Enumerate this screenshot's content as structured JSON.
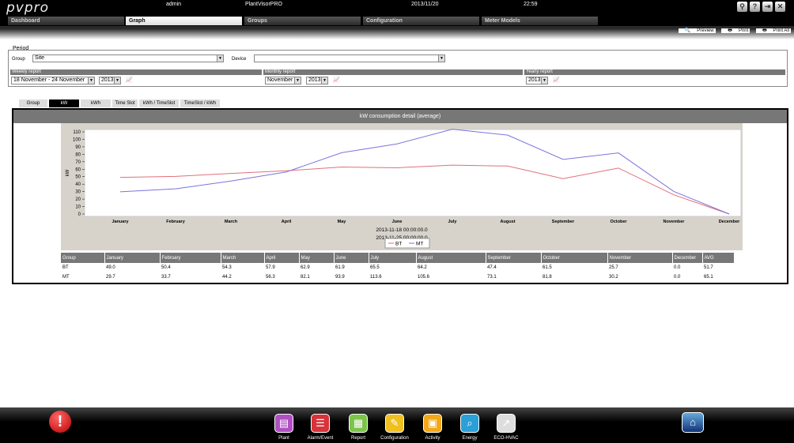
{
  "header": {
    "logo": "pvpro",
    "user": "admin",
    "app_name": "PlantVisorPRO",
    "date": "2013/11/20",
    "time": "22:59"
  },
  "tabs": [
    {
      "label": "Dashboard",
      "active": false
    },
    {
      "label": "Graph",
      "active": true
    },
    {
      "label": "Groups",
      "active": false
    },
    {
      "label": "Configuration",
      "active": false
    },
    {
      "label": "Meter Models",
      "active": false
    }
  ],
  "print_toolbar": {
    "preview": "Preview",
    "print": "Print",
    "print_all": "Print All"
  },
  "period": {
    "legend": "Period",
    "group_label": "Group",
    "group_value": "Site",
    "device_label": "Device",
    "device_value": "",
    "weekly_label": "Weekly report",
    "weekly_range": "18 November - 24 November",
    "weekly_year": "2013",
    "monthly_label": "Monthly report",
    "monthly_month": "November",
    "monthly_year": "2013",
    "yearly_label": "Yearly report",
    "yearly_year": "2013"
  },
  "subtabs": [
    {
      "label": "Group",
      "active": false
    },
    {
      "label": "kW",
      "active": true
    },
    {
      "label": "kWh",
      "active": false
    },
    {
      "label": "Time Slot",
      "active": false
    },
    {
      "label": "kWh / TimeSlot",
      "active": false
    },
    {
      "label": "TimeSlot / kWh",
      "active": false
    }
  ],
  "panel_title": "kW consumption detail (average)",
  "chart_data": {
    "type": "line",
    "categories": [
      "January",
      "February",
      "March",
      "April",
      "May",
      "June",
      "July",
      "August",
      "September",
      "October",
      "November",
      "December"
    ],
    "series": [
      {
        "name": "BT",
        "color": "#e0707a",
        "values": [
          49.0,
          50.4,
          54.3,
          57.9,
          62.9,
          61.9,
          65.5,
          64.2,
          47.4,
          61.5,
          25.7,
          0.0
        ]
      },
      {
        "name": "MT",
        "color": "#7b74dd",
        "values": [
          29.7,
          33.7,
          44.2,
          56.3,
          82.1,
          93.9,
          113.6,
          105.6,
          73.1,
          81.8,
          30.2,
          0.0
        ]
      }
    ],
    "ylabel": "kW",
    "ylim": [
      0,
      110
    ],
    "yticks": [
      0,
      10,
      20,
      30,
      40,
      50,
      60,
      70,
      80,
      90,
      100,
      110
    ],
    "grid": false,
    "period_lines": [
      "2013-11-18 00:00:00.0",
      "2013-11-25 00:00:00.0"
    ],
    "legend_position": "bottom"
  },
  "table": {
    "headers": [
      "Group",
      "January",
      "February",
      "March",
      "April",
      "May",
      "June",
      "July",
      "August",
      "September",
      "October",
      "November",
      "December",
      "AVG"
    ],
    "rows": [
      [
        "BT",
        "49.0",
        "50.4",
        "54.3",
        "57.9",
        "62.9",
        "61.9",
        "65.5",
        "64.2",
        "47.4",
        "61.5",
        "25.7",
        "0.0",
        "51.7"
      ],
      [
        "MT",
        "29.7",
        "33.7",
        "44.2",
        "56.3",
        "82.1",
        "93.9",
        "113.6",
        "105.6",
        "73.1",
        "81.8",
        "30.2",
        "0.0",
        "65.1"
      ]
    ]
  },
  "bottom_nav": [
    {
      "label": "Plant",
      "icon": "plant-icon",
      "color": "#b04fc4"
    },
    {
      "label": "Alarm/Event",
      "icon": "alarm-event-icon",
      "color": "#d8323a"
    },
    {
      "label": "Report",
      "icon": "report-icon",
      "color": "#7cc44a"
    },
    {
      "label": "Configuration",
      "icon": "configuration-icon",
      "color": "#f0c020"
    },
    {
      "label": "Activity",
      "icon": "activity-icon",
      "color": "#f2a818"
    },
    {
      "label": "Energy",
      "icon": "energy-icon",
      "color": "#2a9fd8"
    },
    {
      "label": "ECO-HVAC",
      "icon": "eco-hvac-icon",
      "color": "#dddddd"
    }
  ]
}
